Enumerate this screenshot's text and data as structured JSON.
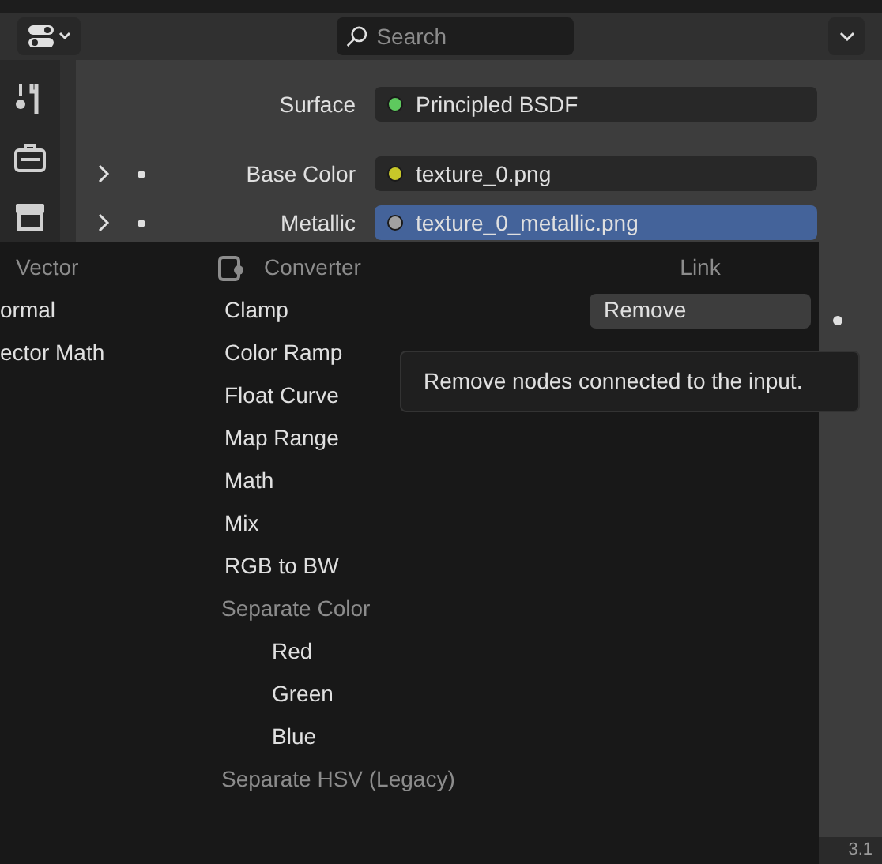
{
  "header": {
    "search": {
      "placeholder": "Search"
    }
  },
  "properties": [
    {
      "label": "Surface",
      "value": "Principled BSDF",
      "color": "#5ec95e",
      "expandable": false,
      "selected": false
    },
    {
      "label": "Base Color",
      "value": "texture_0.png",
      "color": "#c7c729",
      "expandable": true,
      "selected": false
    },
    {
      "label": "Metallic",
      "value": "texture_0_metallic.png",
      "color": "#a1a1a1",
      "expandable": true,
      "selected": true
    }
  ],
  "menu": {
    "columns": [
      {
        "title": "Vector",
        "items": [
          {
            "label": "ormal",
            "kind": "item"
          },
          {
            "label": "ector Math",
            "kind": "item"
          }
        ]
      },
      {
        "title": "Converter",
        "items": [
          {
            "label": "Clamp",
            "kind": "item"
          },
          {
            "label": "Color Ramp",
            "kind": "item"
          },
          {
            "label": "Float Curve",
            "kind": "item"
          },
          {
            "label": "Map Range",
            "kind": "item"
          },
          {
            "label": "Math",
            "kind": "item"
          },
          {
            "label": "Mix",
            "kind": "item"
          },
          {
            "label": "RGB to BW",
            "kind": "item"
          },
          {
            "label": "Separate Color",
            "kind": "subheader"
          },
          {
            "label": "Red",
            "kind": "subitem"
          },
          {
            "label": "Green",
            "kind": "subitem"
          },
          {
            "label": "Blue",
            "kind": "subitem"
          },
          {
            "label": "Separate HSV (Legacy)",
            "kind": "subheader"
          }
        ]
      },
      {
        "title": "Link",
        "items": [
          {
            "label": "Remove",
            "kind": "item",
            "selected": true
          }
        ]
      }
    ]
  },
  "tooltip": {
    "text": "Remove nodes connected to the input."
  },
  "footer": {
    "text": "3.1"
  }
}
